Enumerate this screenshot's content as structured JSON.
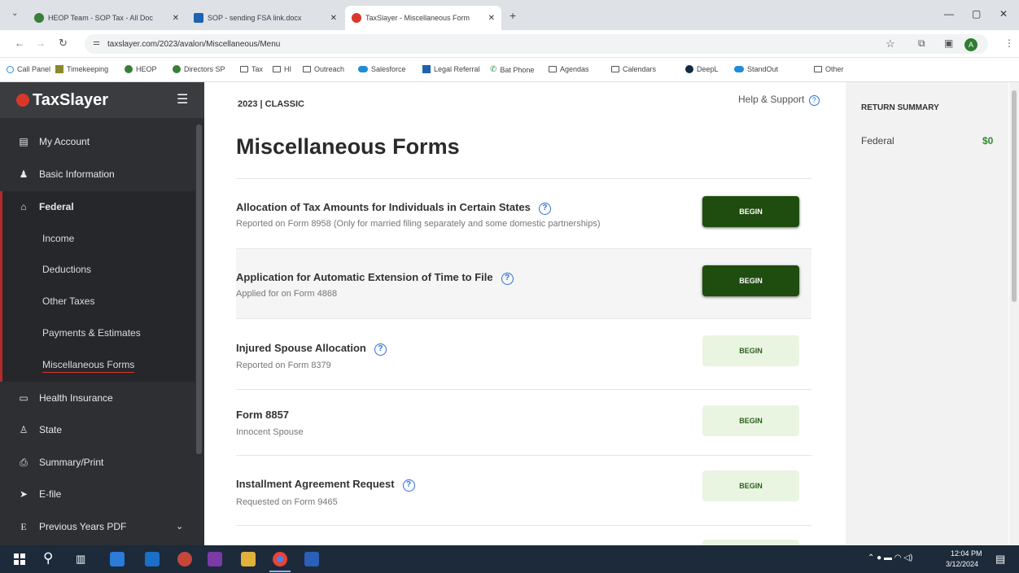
{
  "browser": {
    "tabs": [
      {
        "label": "HEOP Team - SOP Tax - All Doc",
        "color": "#3b7d3b"
      },
      {
        "label": "SOP - sending FSA link.docx",
        "color": "#1e62b0"
      },
      {
        "label": "TaxSlayer - Miscellaneous Form",
        "color": "#d8382c"
      }
    ],
    "new_tab": "+",
    "url": "taxslayer.com/2023/avalon/Miscellaneous/Menu",
    "bookmarks": [
      "Call Panel",
      "Timekeeping",
      "HEOP",
      "Directors SP",
      "Tax",
      "HI",
      "Outreach",
      "Salesforce",
      "Legal Referral",
      "Bat Phone",
      "Agendas",
      "Calendars",
      "DeepL",
      "StandOut",
      "Other"
    ],
    "profile_initial": "A"
  },
  "sidebar": {
    "brand": "TaxSlayer",
    "items": [
      {
        "label": "My Account",
        "icon": "list-icon"
      },
      {
        "label": "Basic Information",
        "icon": "person-icon"
      },
      {
        "label": "Federal",
        "icon": "bank-icon"
      }
    ],
    "sub_items": [
      "Income",
      "Deductions",
      "Other Taxes",
      "Payments & Estimates",
      "Miscellaneous Forms"
    ],
    "items2": [
      {
        "label": "Health Insurance",
        "icon": "card-icon"
      },
      {
        "label": "State",
        "icon": "person-pin-icon"
      },
      {
        "label": "Summary/Print",
        "icon": "printer-icon"
      },
      {
        "label": "E-file",
        "icon": "send-icon"
      },
      {
        "label": "Previous Years PDF",
        "icon": "e-icon"
      }
    ]
  },
  "main": {
    "year_tag": "2023 | CLASSIC",
    "help": "Help & Support",
    "title": "Miscellaneous Forms",
    "forms": [
      {
        "title": "Allocation of Tax Amounts for Individuals in Certain States",
        "subtitle": "Reported on Form 8958 (Only for married filing separately and some domestic partnerships)",
        "button": "BEGIN",
        "help": true
      },
      {
        "title": "Application for Automatic Extension of Time to File",
        "subtitle": "Applied for on Form 4868",
        "button": "BEGIN",
        "help": true
      },
      {
        "title": "Injured Spouse Allocation",
        "subtitle": "Reported on Form 8379",
        "button": "BEGIN",
        "help": true
      },
      {
        "title": "Form 8857",
        "subtitle": "Innocent Spouse",
        "button": "BEGIN",
        "help": false
      },
      {
        "title": "Installment Agreement Request",
        "subtitle": "Requested on Form 9465",
        "button": "BEGIN",
        "help": true
      }
    ]
  },
  "summary": {
    "heading": "RETURN SUMMARY",
    "federal_label": "Federal",
    "federal_value": "$0"
  },
  "taskbar": {
    "time": "12:04 PM",
    "date": "3/12/2024"
  },
  "colors": {
    "brand_red": "#d8382c",
    "begin_dark": "#1f4d0f",
    "begin_light": "#e9f5e0",
    "refund_green": "#2f8a2f"
  }
}
